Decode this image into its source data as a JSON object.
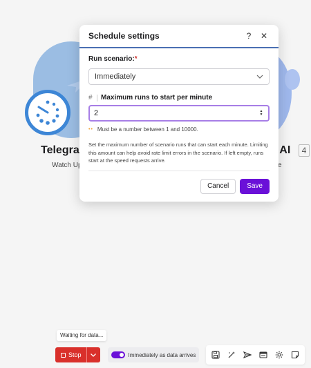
{
  "canvas": {
    "left_module": {
      "title": "Telegra",
      "subtitle": "Watch Up"
    },
    "right_module": {
      "title": "i AI",
      "subtitle": "e",
      "badge": "4"
    }
  },
  "modal": {
    "title": "Schedule settings",
    "help_label": "?",
    "close_label": "✕",
    "run_scenario_label": "Run scenario:",
    "required_mark": "*",
    "run_scenario_value": "Immediately",
    "max_runs_hash": "#",
    "max_runs_label": "Maximum runs to start per minute",
    "max_runs_value": "2",
    "hint_dots": "••",
    "hint": "Must be a number between 1 and 10000.",
    "description": "Set the maximum number of scenario runs that can start each minute. Limiting this amount can help avoid rate limit errors in the scenario. If left empty, runs start at the speed requests arrive.",
    "cancel_label": "Cancel",
    "save_label": "Save"
  },
  "toolbar": {
    "tooltip": "Waiting for data...",
    "stop_label": "Stop",
    "toggle_label": "Immediately as data arrives",
    "icons": [
      "save-icon",
      "magic-wand-icon",
      "flow-icon",
      "notes-icon",
      "gear-icon",
      "sticky-note-icon"
    ]
  },
  "colors": {
    "accent": "#6a10d8",
    "stop_red": "#d9302b",
    "modal_rule": "#4a6fb3",
    "telegram_blue": "#3d86d6"
  }
}
